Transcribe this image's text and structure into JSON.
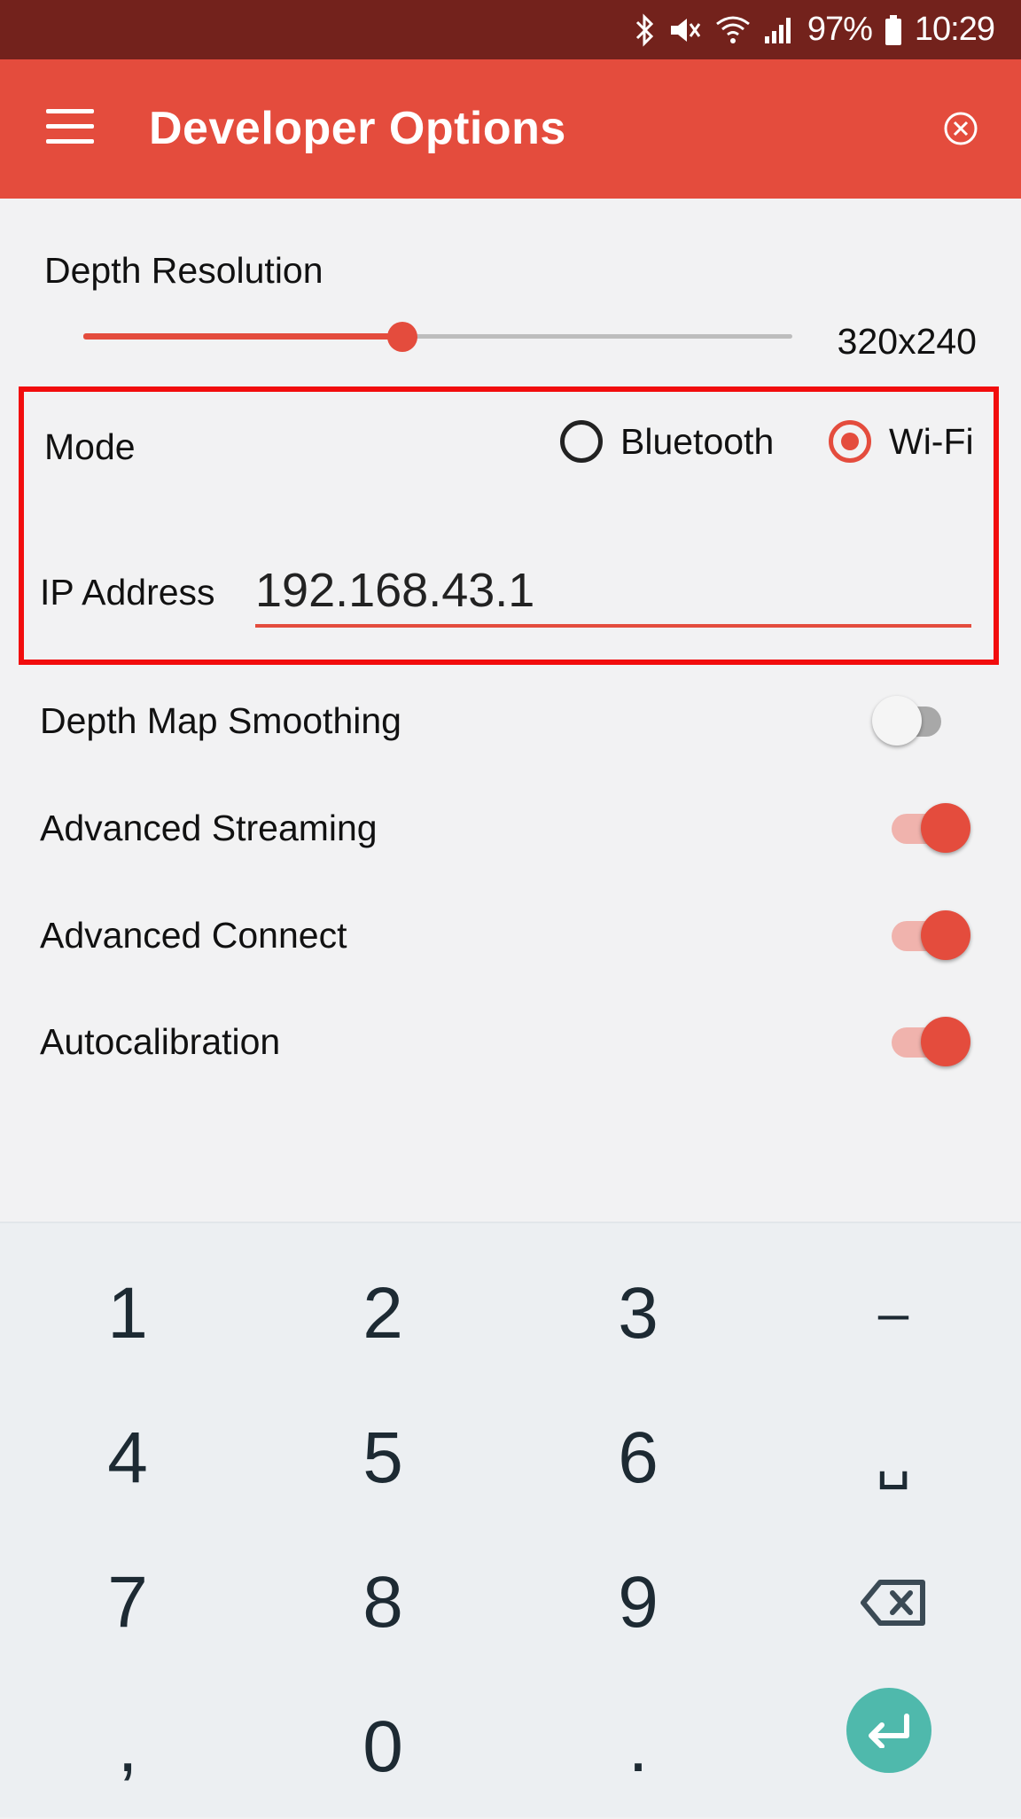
{
  "status_bar": {
    "battery": "97%",
    "time": "10:29",
    "icons": [
      "bluetooth-icon",
      "vibrate-mute-icon",
      "wifi-icon",
      "signal-icon",
      "battery-icon"
    ]
  },
  "app_bar": {
    "title": "Developer Options",
    "menu_icon": "hamburger-menu-icon",
    "close_icon": "close-circle-icon",
    "color": "#e44c3d"
  },
  "settings": {
    "depth_resolution": {
      "label": "Depth Resolution",
      "value": "320x240",
      "slider_level": 0.45
    },
    "mode": {
      "label": "Mode",
      "options": [
        "Bluetooth",
        "Wi-Fi"
      ],
      "selected": "Wi-Fi"
    },
    "ip_address": {
      "label": "IP Address",
      "value": "192.168.43.1"
    },
    "toggles": [
      {
        "label": "Depth Map Smoothing",
        "on": false
      },
      {
        "label": "Advanced Streaming",
        "on": true
      },
      {
        "label": "Advanced Connect",
        "on": true
      },
      {
        "label": "Autocalibration",
        "on": true
      }
    ]
  },
  "keyboard": {
    "rows": [
      [
        "1",
        "2",
        "3",
        "–"
      ],
      [
        "4",
        "5",
        "6",
        "␣"
      ],
      [
        "7",
        "8",
        "9",
        "backspace"
      ],
      [
        ",",
        "0",
        ".",
        "enter"
      ]
    ],
    "enter_color": "#4fb9ac"
  },
  "colors": {
    "status_bar": "#73221c",
    "accent": "#e44c3d",
    "highlight_box": "#f20d0d"
  }
}
